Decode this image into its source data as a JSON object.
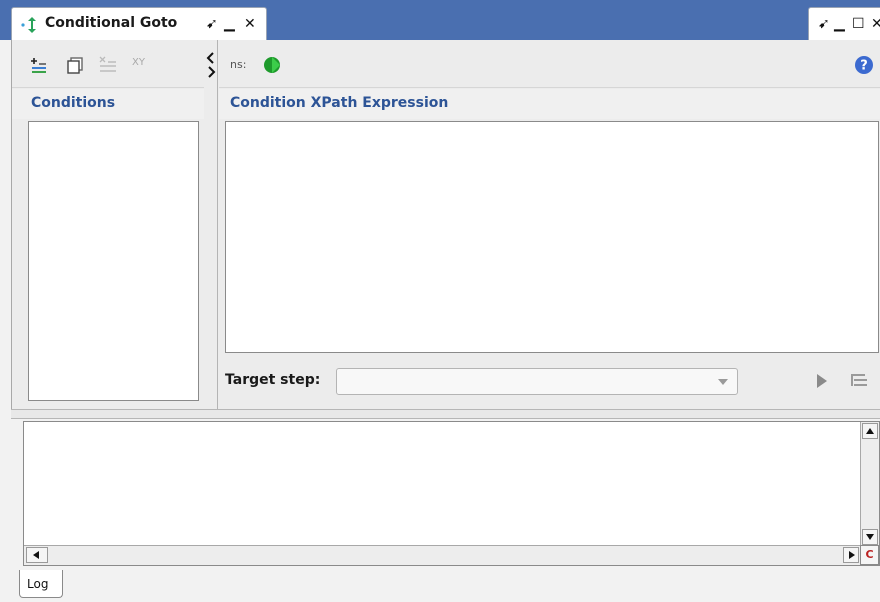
{
  "window": {
    "tab_title": "Conditional Goto",
    "tab_icon": "conditional-goto-icon",
    "tab_buttons": [
      "pin-icon",
      "minimize-icon",
      "close-icon"
    ],
    "window_buttons": [
      "pin-icon",
      "minimize-icon",
      "maximize-icon",
      "close-icon"
    ],
    "glyphs": {
      "pin": "➹",
      "minimize": "▁",
      "close": "✕",
      "maximize": "☐"
    }
  },
  "conditions_panel": {
    "title": "Conditions",
    "toolbar": [
      {
        "name": "add-condition-icon"
      },
      {
        "name": "copy-condition-icon"
      },
      {
        "name": "delete-condition-icon"
      },
      {
        "name": "xpath-builder-icon",
        "label": "XY"
      }
    ]
  },
  "xpath_panel": {
    "title": "Condition XPath Expression",
    "ns_label": "ns:",
    "run_icon": "run-icon",
    "help_icon": "help-icon",
    "target_step_label": "Target step:",
    "target_step_value": "",
    "go_icon": "go-to-step-icon",
    "steps_icon": "step-list-icon"
  },
  "log": {
    "content": "",
    "tab_label": "Log",
    "corner_label": "C"
  },
  "colors": {
    "titlebar": "#4a6fb0",
    "section_title": "#2d5496",
    "run_green": "#1e9a2c",
    "help_blue": "#3c6ad0"
  }
}
